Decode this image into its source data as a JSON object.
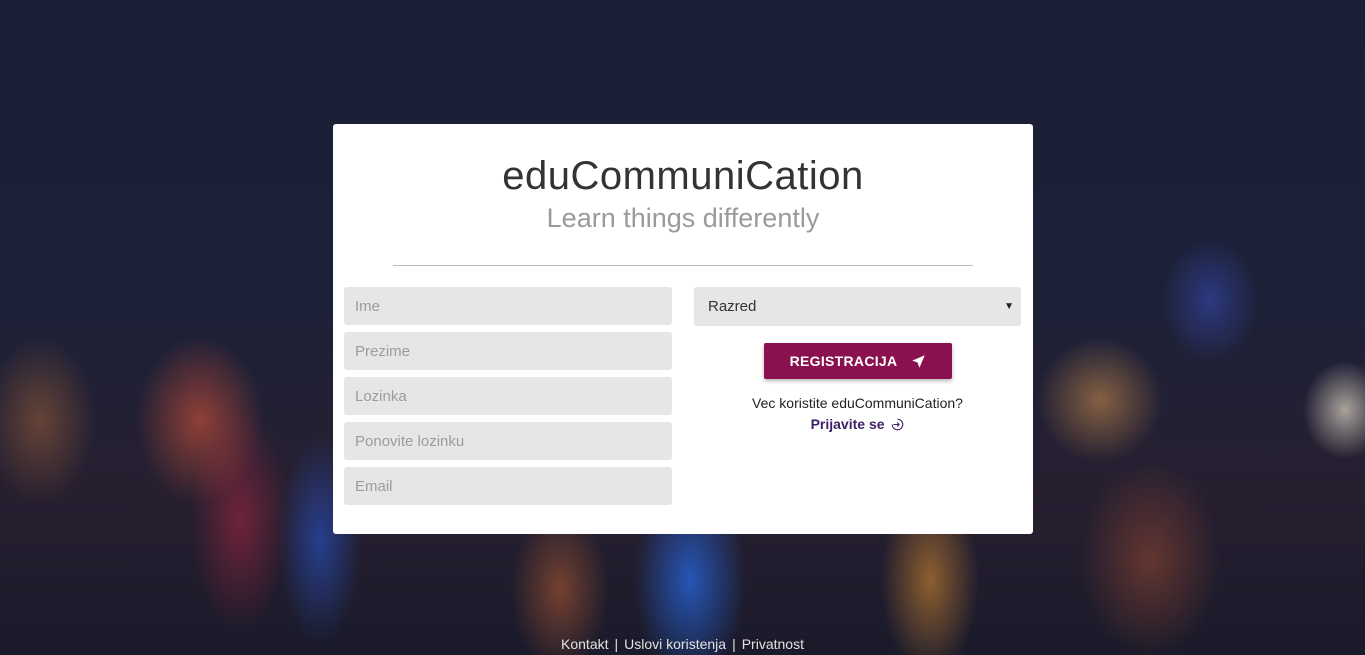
{
  "brand": {
    "title": "eduCommuniCation",
    "tagline": "Learn things differently"
  },
  "form": {
    "fields": [
      {
        "placeholder": "Ime",
        "value": ""
      },
      {
        "placeholder": "Prezime",
        "value": ""
      },
      {
        "placeholder": "Lozinka",
        "value": ""
      },
      {
        "placeholder": "Ponovite lozinku",
        "value": ""
      },
      {
        "placeholder": "Email",
        "value": ""
      }
    ],
    "select": {
      "selected": "Razred"
    },
    "submit_label": "REGISTRACIJA",
    "already_text": "Vec koristite eduCommuniCation?",
    "login_link": "Prijavite se"
  },
  "footer": {
    "links": [
      "Kontakt",
      "Uslovi koristenja",
      "Privatnost"
    ],
    "separator": "|"
  },
  "colors": {
    "accent": "#8a1050",
    "link": "#3d1f66",
    "field_bg": "#e6e6e6"
  },
  "icons": {
    "submit": "send-icon",
    "login": "sign-in-icon",
    "select": "caret-down-icon"
  }
}
